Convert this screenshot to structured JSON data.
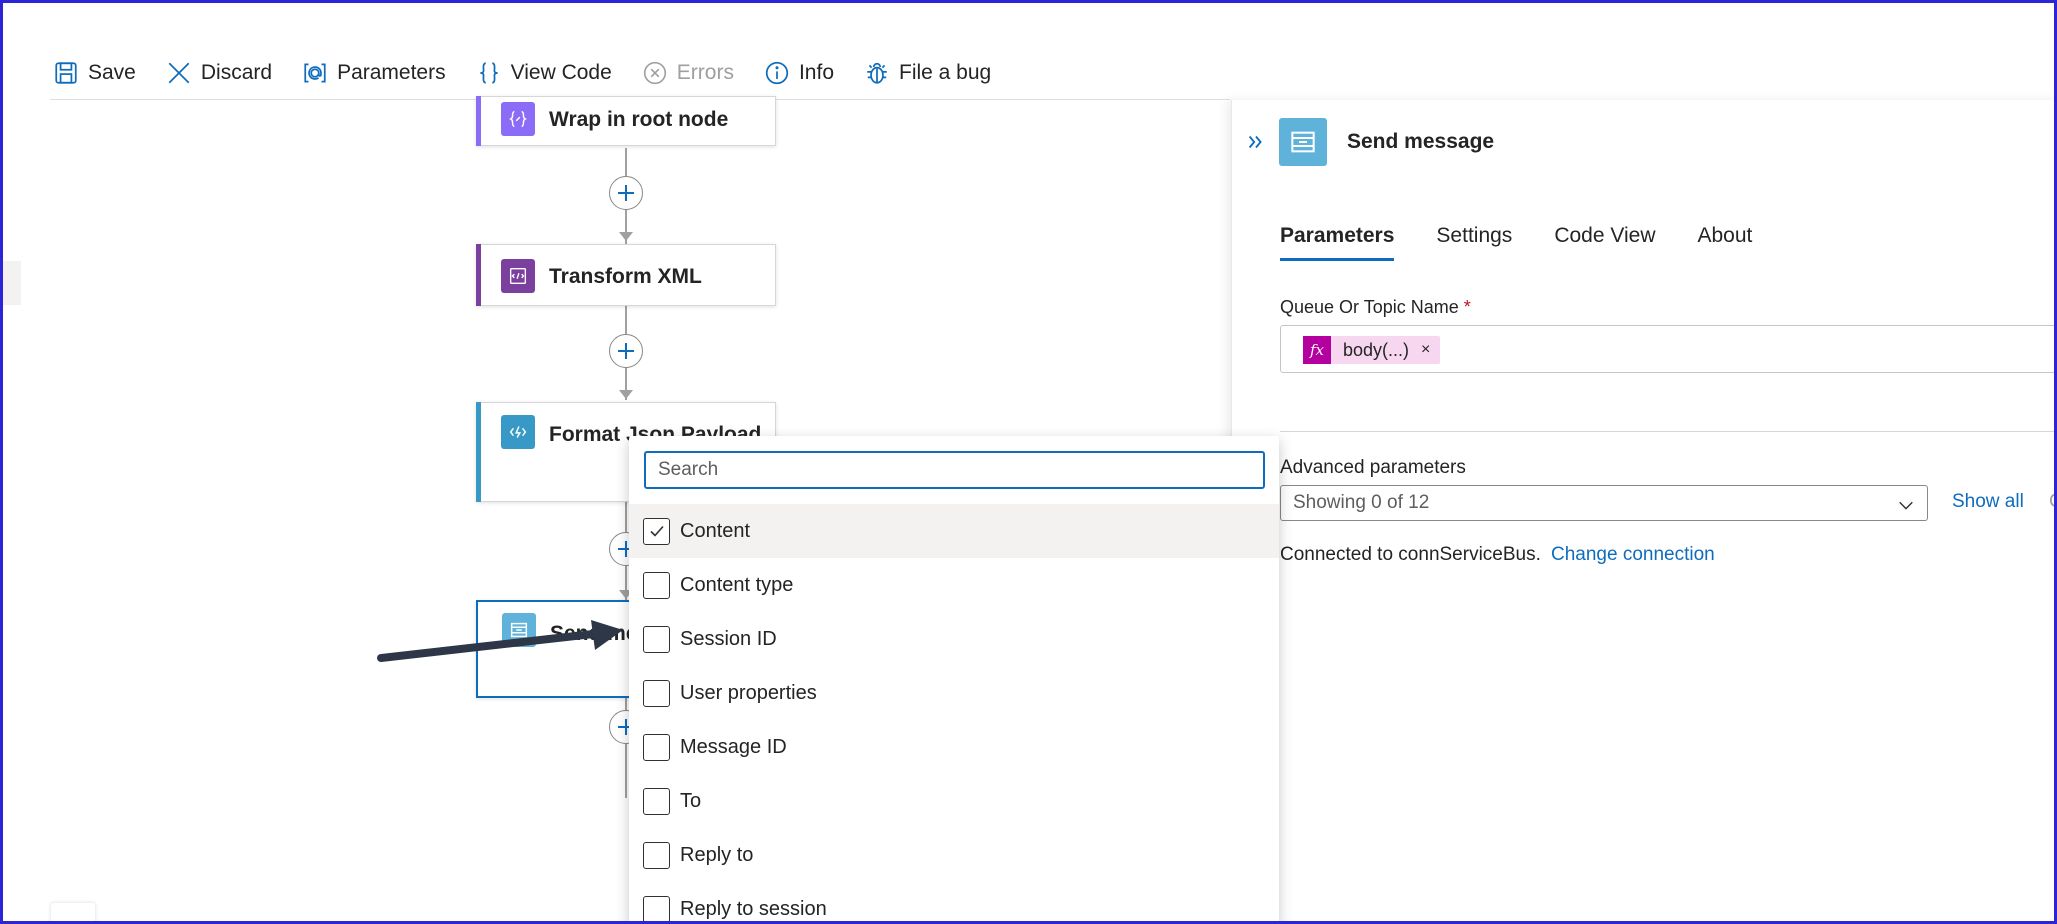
{
  "toolbar": {
    "save": "Save",
    "discard": "Discard",
    "parameters": "Parameters",
    "view_code": "View Code",
    "errors": "Errors",
    "info": "Info",
    "file_bug": "File a bug"
  },
  "canvas": {
    "cards": [
      {
        "title": "Wrap in root node",
        "accent": "#8b6cf6"
      },
      {
        "title": "Transform XML",
        "accent": "#7b3f9e"
      },
      {
        "title": "Format Json Payload",
        "accent": "#3999c6"
      },
      {
        "title": "Send me",
        "accent": "#0f6cbd"
      }
    ]
  },
  "dropdown": {
    "search_placeholder": "Search",
    "items": [
      {
        "label": "Content",
        "checked": true
      },
      {
        "label": "Content type",
        "checked": false
      },
      {
        "label": "Session ID",
        "checked": false
      },
      {
        "label": "User properties",
        "checked": false
      },
      {
        "label": "Message ID",
        "checked": false
      },
      {
        "label": "To",
        "checked": false
      },
      {
        "label": "Reply to",
        "checked": false
      },
      {
        "label": "Reply to session",
        "checked": false
      }
    ]
  },
  "panel": {
    "title": "Send message",
    "tabs": [
      "Parameters",
      "Settings",
      "Code View",
      "About"
    ],
    "queue_label": "Queue Or Topic Name",
    "required_mark": "*",
    "token_fx": "fx",
    "token_text": "body(...)",
    "token_remove": "×",
    "advanced_label": "Advanced parameters",
    "advanced_value": "Showing 0 of 12",
    "show_all": "Show all",
    "show_all_extra": "C",
    "connected_text": "Connected to connServiceBus.",
    "change_connection": "Change connection"
  },
  "colors": {
    "accent": "#0f6cbd",
    "frame_border": "#2b25d6",
    "service_bus": "#5fb3db",
    "expression": "#b4009e"
  }
}
